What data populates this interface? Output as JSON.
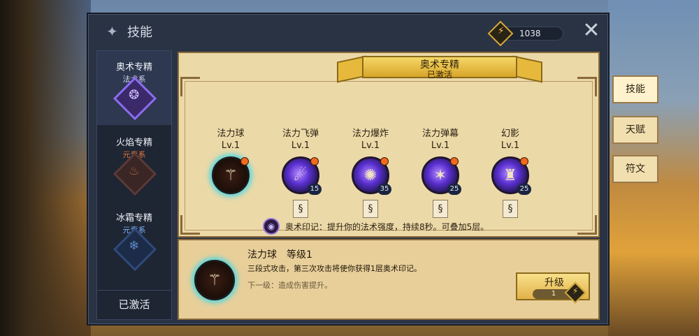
{
  "header": {
    "title": "技能",
    "currency_value": "1038"
  },
  "specs": [
    {
      "name": "奥术专精",
      "school": "法术系",
      "active": true
    },
    {
      "name": "火焰专精",
      "school": "元素系",
      "active": false
    },
    {
      "name": "冰霜专精",
      "school": "元素系",
      "active": false
    }
  ],
  "spec_footer": "已激活",
  "banner": {
    "title": "奥术专精",
    "status": "已激活"
  },
  "skills": [
    {
      "name": "法力球",
      "level": "Lv.1",
      "cost": ""
    },
    {
      "name": "法力飞弹",
      "level": "Lv.1",
      "cost": "15"
    },
    {
      "name": "法力爆炸",
      "level": "Lv.1",
      "cost": "35"
    },
    {
      "name": "法力弹幕",
      "level": "Lv.1",
      "cost": "25"
    },
    {
      "name": "幻影",
      "level": "Lv.1",
      "cost": "25"
    }
  ],
  "passive": {
    "text": "奥术印记：提升你的法术强度，持续8秒。可叠加5层。"
  },
  "detail": {
    "title": "法力球　等级1",
    "description": "三段式攻击，第三次攻击将使你获得1层奥术印记。",
    "next_level": "下一级：造成伤害提升。",
    "upgrade_label": "升级",
    "upgrade_cost": "1"
  },
  "side_tabs": [
    {
      "label": "技能",
      "active": true
    },
    {
      "label": "天赋",
      "active": false
    },
    {
      "label": "符文",
      "active": false
    }
  ],
  "colors": {
    "panel": "#2a3344",
    "parchment": "#ecd9a8",
    "arcane": "#8c6cf0",
    "fire_school": "#e8763a",
    "arcane_school": "#d9d4ff",
    "frost_school": "#7fb6ff",
    "gold": "#d7a93a",
    "selection_glow": "#3fd7e8"
  }
}
